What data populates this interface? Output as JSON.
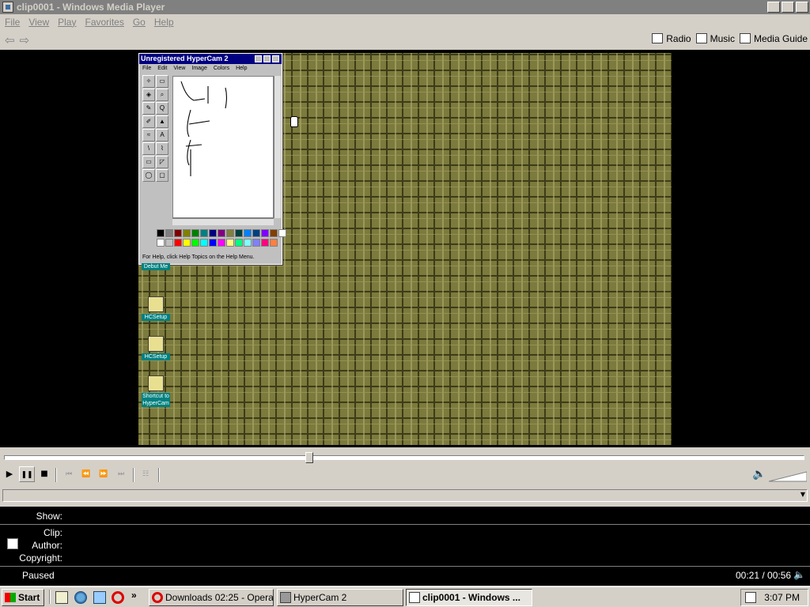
{
  "window": {
    "title": "clip0001 - Windows Media Player",
    "btn_min": "_",
    "btn_restore": "❐",
    "btn_close": "x"
  },
  "menu": [
    "File",
    "View",
    "Play",
    "Favorites",
    "Go",
    "Help"
  ],
  "nav": {
    "back": "⇦",
    "forward": "⇨",
    "radio": "Radio",
    "music": "Music",
    "guide": "Media Guide"
  },
  "video": {
    "hypercam": {
      "title": "Unregistered HyperCam 2",
      "menu": [
        "File",
        "Edit",
        "View",
        "Image",
        "Colors",
        "Help"
      ],
      "tools": [
        "✧",
        "▭",
        "◈",
        "⌕",
        "✎",
        "Q",
        "✐",
        "▲",
        "≈",
        "A",
        "\\",
        "⌇",
        "▭",
        "◸",
        "◯",
        "▢"
      ],
      "palette": [
        "#000000",
        "#808080",
        "#800000",
        "#808000",
        "#008000",
        "#008080",
        "#000080",
        "#800080",
        "#808040",
        "#004040",
        "#0080ff",
        "#004080",
        "#8000ff",
        "#804000",
        "#ffffff",
        "#ffffff",
        "#c0c0c0",
        "#ff0000",
        "#ffff00",
        "#00ff00",
        "#00ffff",
        "#0000ff",
        "#ff00ff",
        "#ffff80",
        "#00ff80",
        "#80ffff",
        "#8080ff",
        "#ff0080",
        "#ff8040"
      ],
      "status": "For Help, click Help Topics on the Help Menu."
    },
    "icons": [
      {
        "label": "Debut Me"
      },
      {
        "label": "HCSetup"
      },
      {
        "label": "HCSetup"
      },
      {
        "label": "Shortcut to HyperCam"
      }
    ]
  },
  "seek": {
    "position_fraction": 0.38
  },
  "controls": {
    "play": "▶",
    "pause": "❚❚",
    "stop": "■",
    "prev": "⏮",
    "rewind": "⏪",
    "ff": "⏩",
    "next": "⏭",
    "playlist": "☷",
    "mute": "🔈"
  },
  "info": {
    "show_label": "Show:",
    "clip_label": "Clip:",
    "author_label": "Author:",
    "copyright_label": "Copyright:",
    "status": "Paused",
    "time": "00:21 / 00:56",
    "speaker": "🔈"
  },
  "taskbar": {
    "start": "Start",
    "quicklaunch_more": "»",
    "tasks": [
      "Downloads 02:25 - Opera",
      "HyperCam 2",
      "clip0001 - Windows ..."
    ],
    "clock": "3:07 PM"
  }
}
